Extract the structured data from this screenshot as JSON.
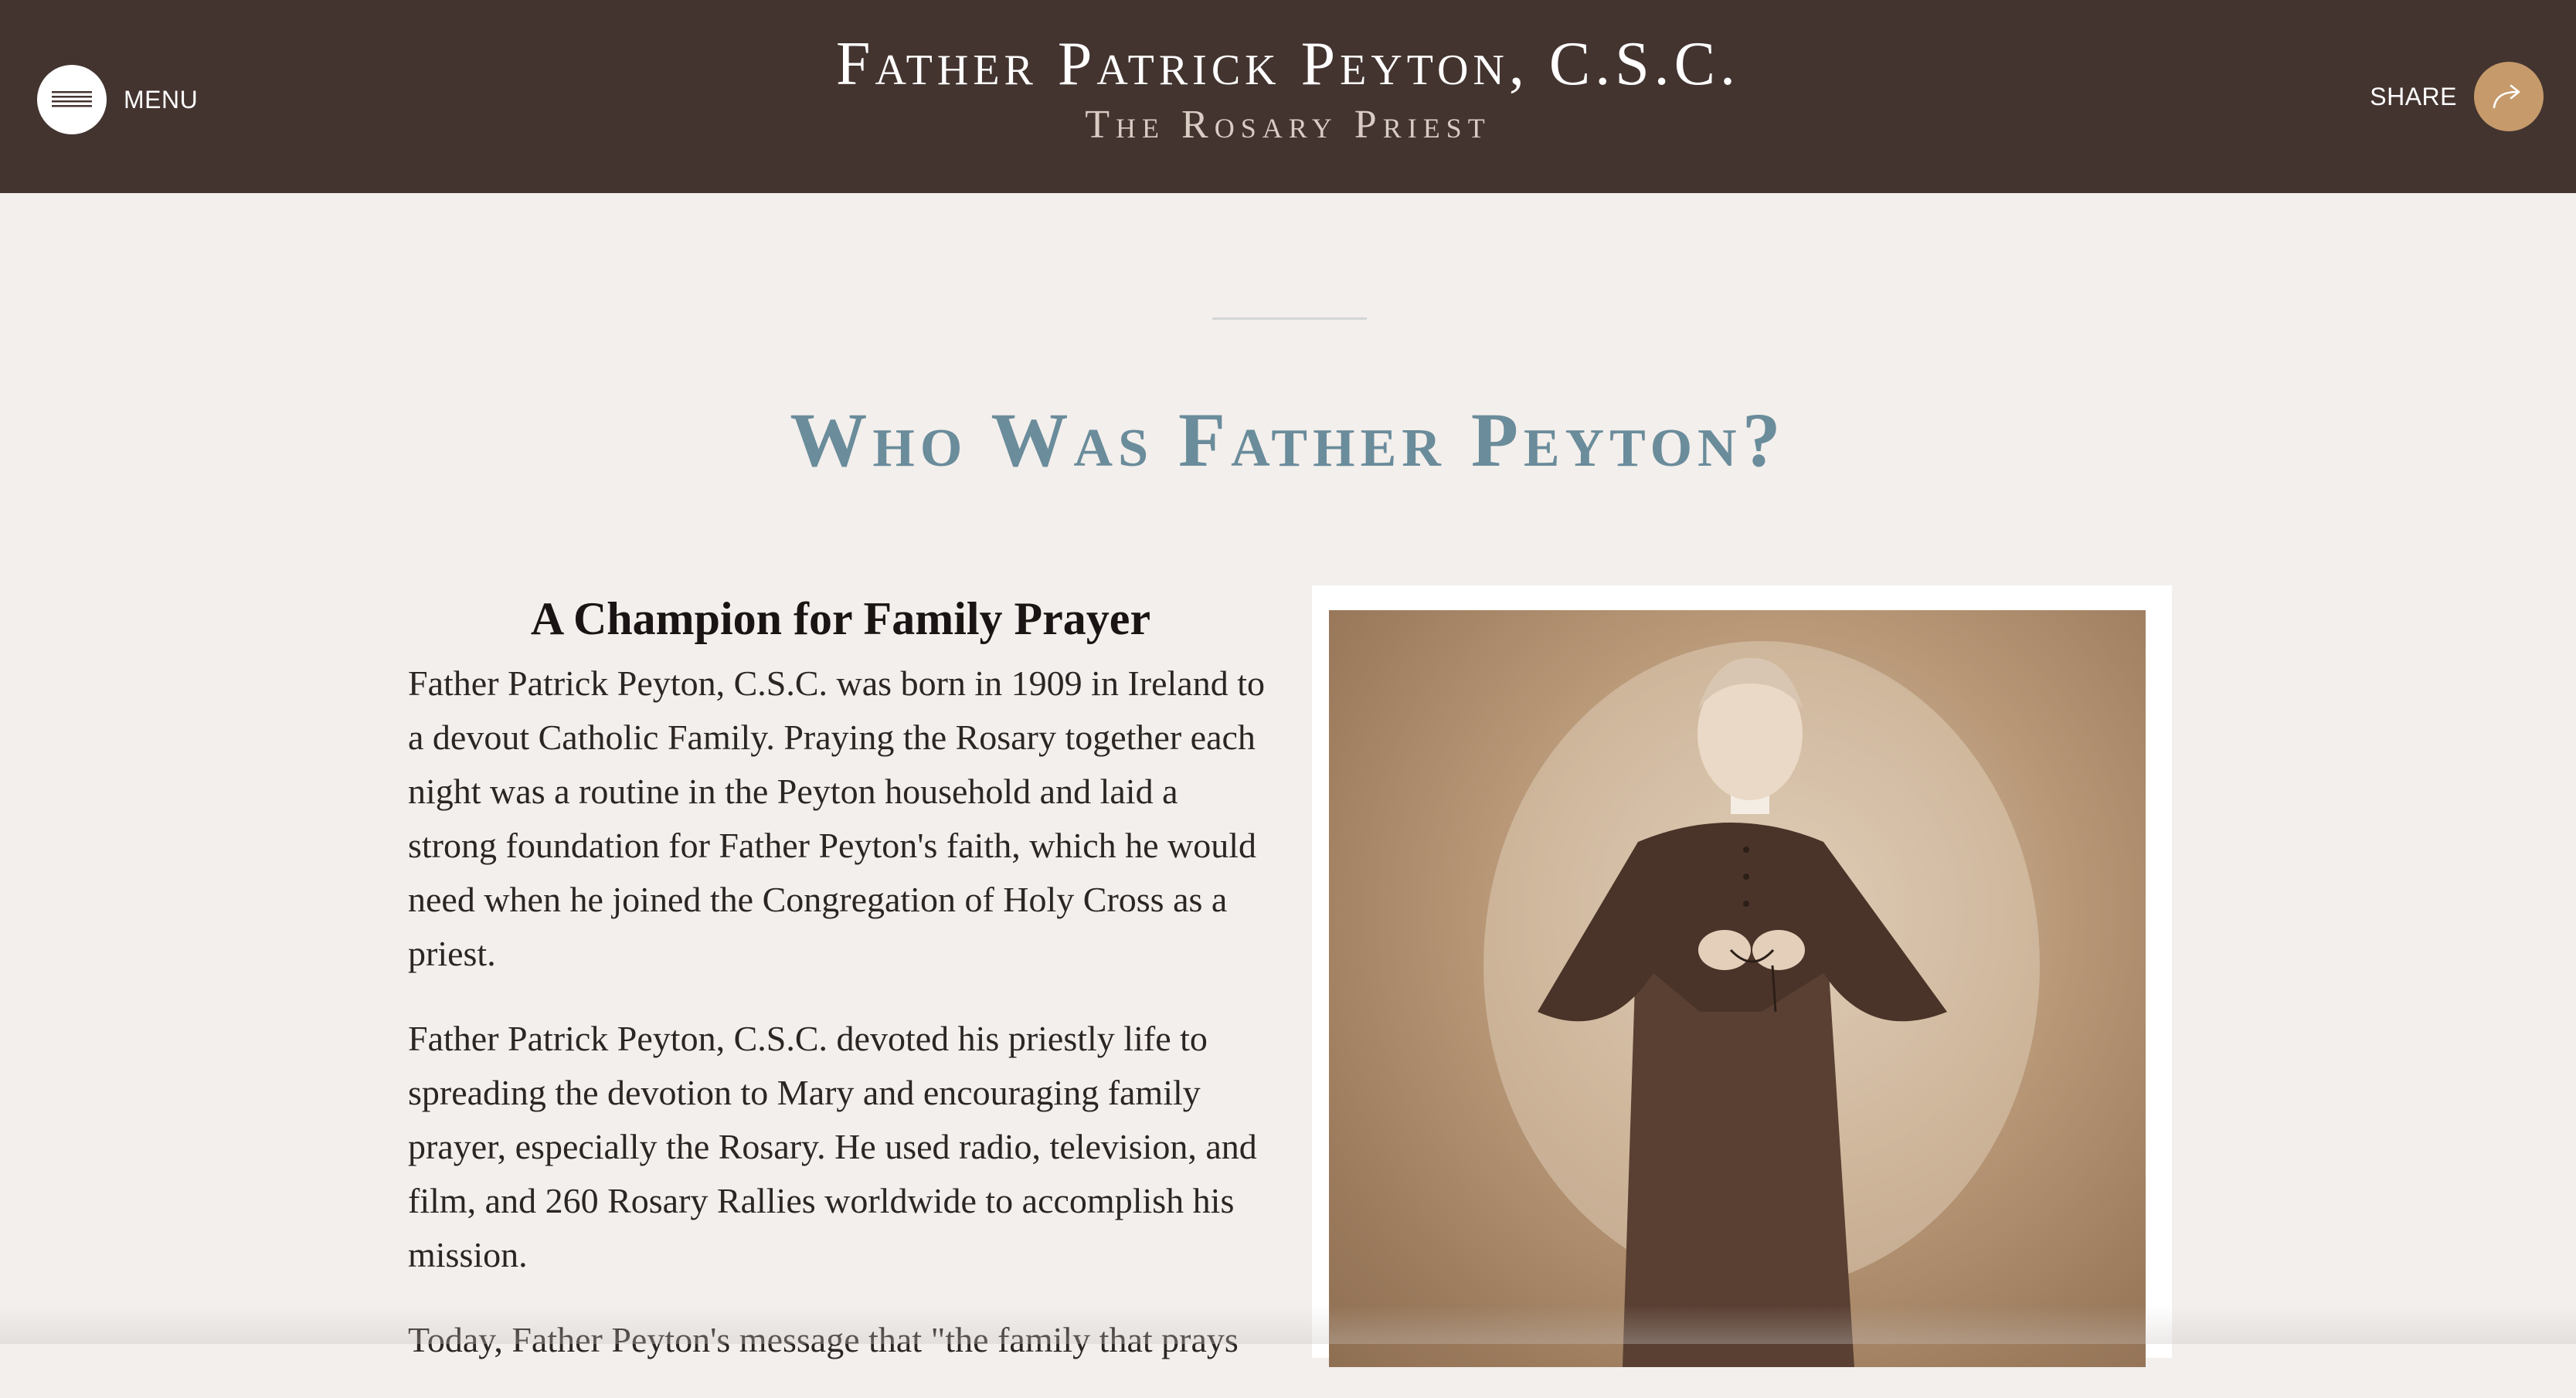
{
  "header": {
    "menu_label": "MENU",
    "menu_icon": "hamburger-icon",
    "title": "Father Patrick Peyton, C.S.C.",
    "subtitle": "The Rosary Priest",
    "share_label": "SHARE",
    "share_icon": "share-arrow-icon"
  },
  "main": {
    "heading": "Who Was Father Peyton?",
    "subheading": "A Champion for Family Prayer",
    "paragraphs": [
      "Father Patrick Peyton, C.S.C. was born in 1909 in Ireland to a devout Catholic Family. Praying the Rosary together each night was a routine in the Peyton household and laid a strong foundation for Father Peyton's faith, which he would need when he joined the Congregation of Holy Cross as a priest.",
      "Father Patrick Peyton, C.S.C. devoted his priestly life to spreading the devotion to Mary and encouraging family prayer, especially the Rosary. He used radio, television, and film, and 260 Rosary Rallies worldwide to accomplish his mission.",
      "Today, Father Peyton's message that \"the family that prays"
    ]
  },
  "colors": {
    "header_bg": "#433430",
    "page_bg": "#f3efec",
    "heading_accent": "#6a8c9b",
    "share_accent": "#c69a6a"
  }
}
